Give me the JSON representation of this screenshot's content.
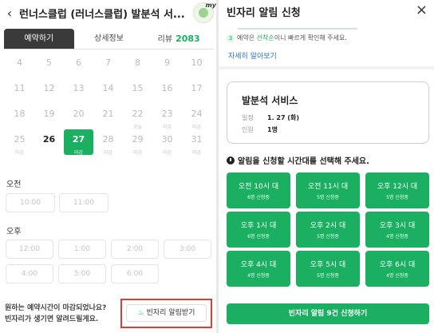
{
  "left": {
    "title": "런너스클럽 (러너스클럽) 발분석 서...",
    "avatar_badge": "my",
    "tabs": [
      {
        "label": "예약하기"
      },
      {
        "label": "상세정보"
      },
      {
        "label": "리뷰",
        "count": "2083"
      }
    ],
    "calendar_rows": [
      [
        {
          "n": "4",
          "s": ""
        },
        {
          "n": "5",
          "s": ""
        },
        {
          "n": "6",
          "s": ""
        },
        {
          "n": "7",
          "s": ""
        },
        {
          "n": "8",
          "s": ""
        },
        {
          "n": "9",
          "s": ""
        },
        {
          "n": "10",
          "s": ""
        }
      ],
      [
        {
          "n": "11",
          "s": ""
        },
        {
          "n": "12",
          "s": ""
        },
        {
          "n": "13",
          "s": ""
        },
        {
          "n": "14",
          "s": ""
        },
        {
          "n": "15",
          "s": ""
        },
        {
          "n": "16",
          "s": ""
        },
        {
          "n": "17",
          "s": ""
        }
      ],
      [
        {
          "n": "18",
          "s": ""
        },
        {
          "n": "19",
          "s": ""
        },
        {
          "n": "20",
          "s": ""
        },
        {
          "n": "21",
          "s": ""
        },
        {
          "n": "22",
          "s": "오늘"
        },
        {
          "n": "23",
          "s": "마감"
        },
        {
          "n": "24",
          "s": "마감"
        }
      ],
      [
        {
          "n": "25",
          "s": "마감"
        },
        {
          "n": "26",
          "s": ""
        },
        {
          "n": "27",
          "s": "마감"
        },
        {
          "n": "28",
          "s": "마감"
        },
        {
          "n": "29",
          "s": "마감"
        },
        {
          "n": "30",
          "s": "마감"
        },
        {
          "n": "31",
          "s": "마감"
        }
      ]
    ],
    "morning_label": "오전",
    "morning_slots": [
      "10:00",
      "11:00"
    ],
    "afternoon_label": "오후",
    "afternoon_slots": [
      "12:00",
      "1:00",
      "2:00",
      "3:00",
      "4:00",
      "5:00",
      "6:00"
    ],
    "notice_line1": "원하는 예약시간이 마감되었나요?",
    "notice_line2": "빈자리가 생기면 알려드릴게요.",
    "alarm_button": "빈자리 알림받기"
  },
  "right": {
    "title": "빈자리 알림 신청",
    "close_icon": "×",
    "info_line2_num": "3",
    "info_line2_pre": "예약은 ",
    "info_line2_green": "선착순",
    "info_line2_post": "이니 빠르게 확인해 주세요.",
    "more_link": "자세히 알아보기",
    "service": {
      "title": "발분석 서비스",
      "date_label": "일정",
      "date_value": "1. 27 (화)",
      "people_label": "인원",
      "people_value": "1명"
    },
    "choose_label": "알림을 신청할 시간대를 선택해 주세요.",
    "slots": [
      {
        "time": "오전 10시 대",
        "status": "6명 신청중"
      },
      {
        "time": "오전 11시 대",
        "status": "5명 신청중"
      },
      {
        "time": "오후 12시 대",
        "status": "5명 신청중"
      },
      {
        "time": "오후 1시 대",
        "status": "6명 신청중"
      },
      {
        "time": "오후 2시 대",
        "status": "5명 신청중"
      },
      {
        "time": "오후 3시 대",
        "status": "4명 신청중"
      },
      {
        "time": "오후 4시 대",
        "status": "4명 신청중"
      },
      {
        "time": "오후 5시 대",
        "status": "5명 신청중"
      },
      {
        "time": "오후 6시 대",
        "status": "4명 신청중"
      }
    ],
    "apply_button": "빈자리 알림 9건 신청하기"
  },
  "colors": {
    "accent": "#1bb061",
    "highlight": "#e53935",
    "link": "#2a6fd6"
  }
}
